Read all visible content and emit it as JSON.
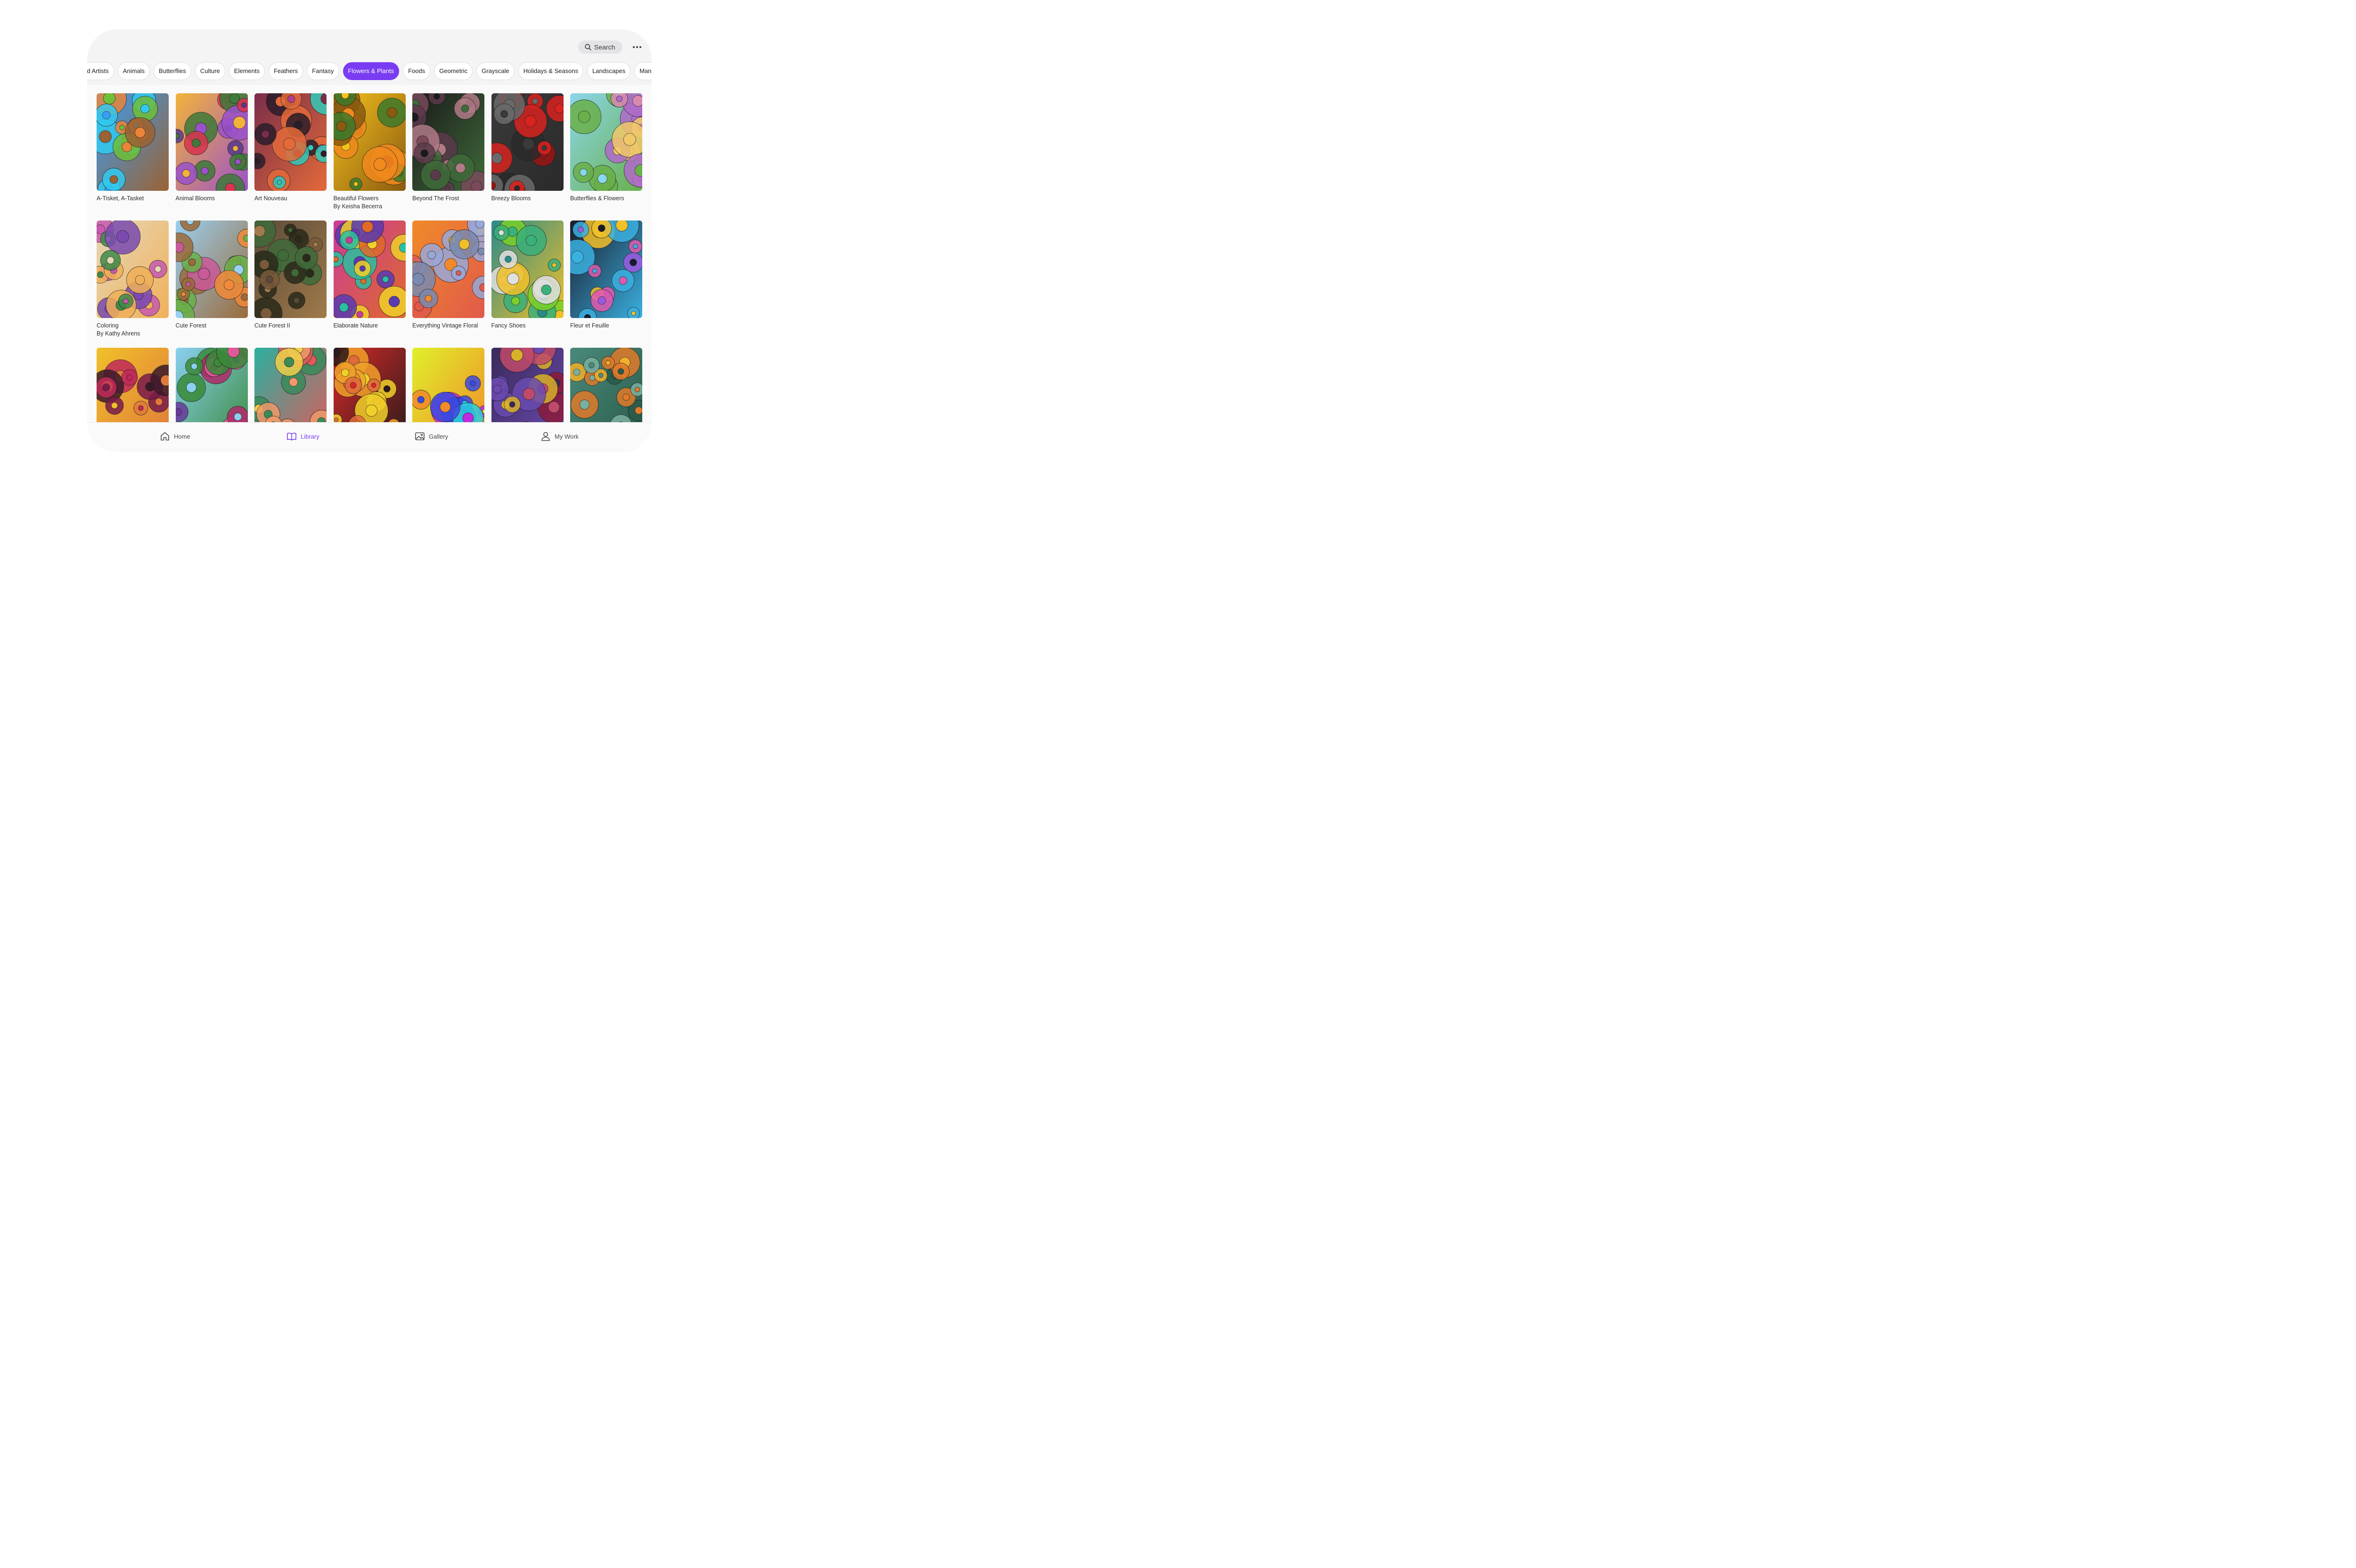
{
  "colors": {
    "accent": "#7a3cf2",
    "chip_bg": "#ffffff",
    "screen_bg": "#f4f4f5"
  },
  "header": {
    "search_label": "Search",
    "search_icon": "search-icon",
    "more_icon": "more-horizontal-icon"
  },
  "categories": {
    "selected": "Flowers & Plants",
    "items": [
      "red Artists",
      "Animals",
      "Butterflies",
      "Culture",
      "Elements",
      "Feathers",
      "Fantasy",
      "Flowers & Plants",
      "Foods",
      "Geometric",
      "Grayscale",
      "Holidays & Seasons",
      "Landscapes",
      "Mandalas"
    ]
  },
  "books": [
    {
      "title": "A-Tisket, A-Tasket",
      "subtitle": ""
    },
    {
      "title": "Animal Blooms",
      "subtitle": ""
    },
    {
      "title": "Art Nouveau",
      "subtitle": ""
    },
    {
      "title": "Beautiful Flowers",
      "subtitle": "By Keisha Becerra"
    },
    {
      "title": "Beyond The Frost",
      "subtitle": ""
    },
    {
      "title": "Breezy Blooms",
      "subtitle": ""
    },
    {
      "title": "Butterflies & Flowers",
      "subtitle": ""
    },
    {
      "title": "Coloring",
      "subtitle": "By Kathy Ahrens"
    },
    {
      "title": "Cute Forest",
      "subtitle": ""
    },
    {
      "title": "Cute Forest II",
      "subtitle": ""
    },
    {
      "title": "Elaborate Nature",
      "subtitle": ""
    },
    {
      "title": "Everything Vintage Floral",
      "subtitle": ""
    },
    {
      "title": "Fancy Shoes",
      "subtitle": ""
    },
    {
      "title": "Fleur et Feuille",
      "subtitle": ""
    },
    {
      "title": "",
      "subtitle": ""
    },
    {
      "title": "",
      "subtitle": ""
    },
    {
      "title": "",
      "subtitle": ""
    },
    {
      "title": "",
      "subtitle": ""
    },
    {
      "title": "",
      "subtitle": ""
    },
    {
      "title": "",
      "subtitle": ""
    },
    {
      "title": "",
      "subtitle": ""
    }
  ],
  "tabs": [
    {
      "label": "Home",
      "icon": "home-icon",
      "active": false
    },
    {
      "label": "Library",
      "icon": "book-icon",
      "active": true
    },
    {
      "label": "Gallery",
      "icon": "image-icon",
      "active": false
    },
    {
      "label": "My Work",
      "icon": "person-icon",
      "active": false
    }
  ]
}
